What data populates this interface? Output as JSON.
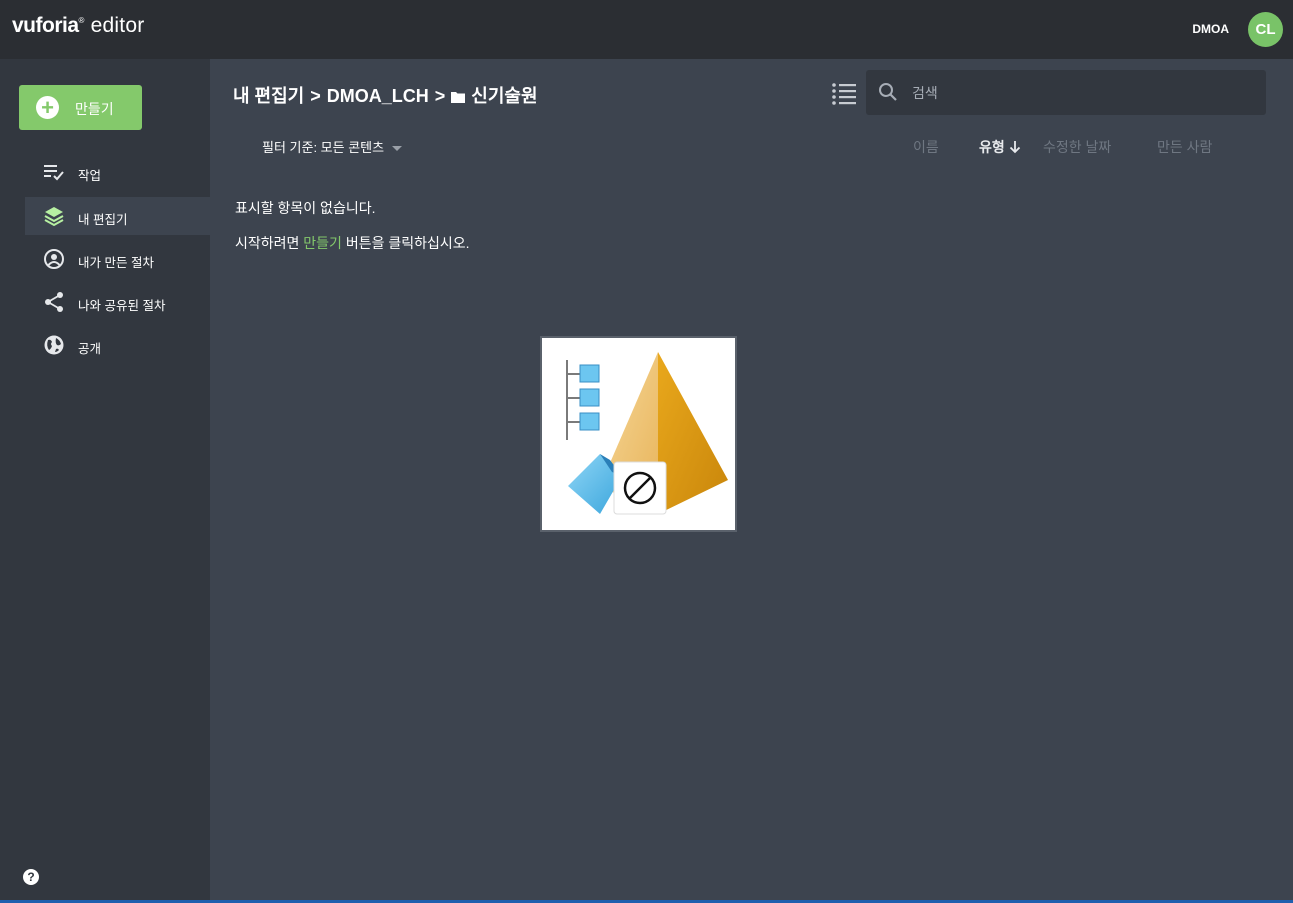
{
  "header": {
    "brand": "vuforia",
    "brand_mark": "®",
    "app": "editor",
    "org": "DMOA",
    "avatar_initials": "CL",
    "avatar_color": "#79c368"
  },
  "sidebar": {
    "create_label": "만들기",
    "items": [
      {
        "label": "작업",
        "icon": "task-list-icon"
      },
      {
        "label": "내 편집기",
        "icon": "layers-icon",
        "active": true
      },
      {
        "label": "내가 만든 절차",
        "icon": "user-circle-icon"
      },
      {
        "label": "나와 공유된 절차",
        "icon": "share-icon"
      },
      {
        "label": "공개",
        "icon": "globe-icon"
      }
    ],
    "help": "?"
  },
  "main": {
    "breadcrumb": {
      "root": "내 편집기",
      "sep": ">",
      "org": "DMOA_LCH",
      "folder": "신기술원"
    },
    "search_placeholder": "검색",
    "filter_label": "필터 기준: 모든 콘텐츠",
    "columns": {
      "name": "이름",
      "type": "유형",
      "modified": "수정한 날짜",
      "creator": "만든 사람",
      "sorted_by": "type",
      "sort_direction": "descending"
    },
    "empty_title": "표시할 항목이 없습니다.",
    "empty_hint_prefix": "시작하려면",
    "empty_hint_link": "만들기",
    "empty_hint_suffix": "버튼을 클릭하십시오.",
    "accent_color": "#84c96b"
  }
}
